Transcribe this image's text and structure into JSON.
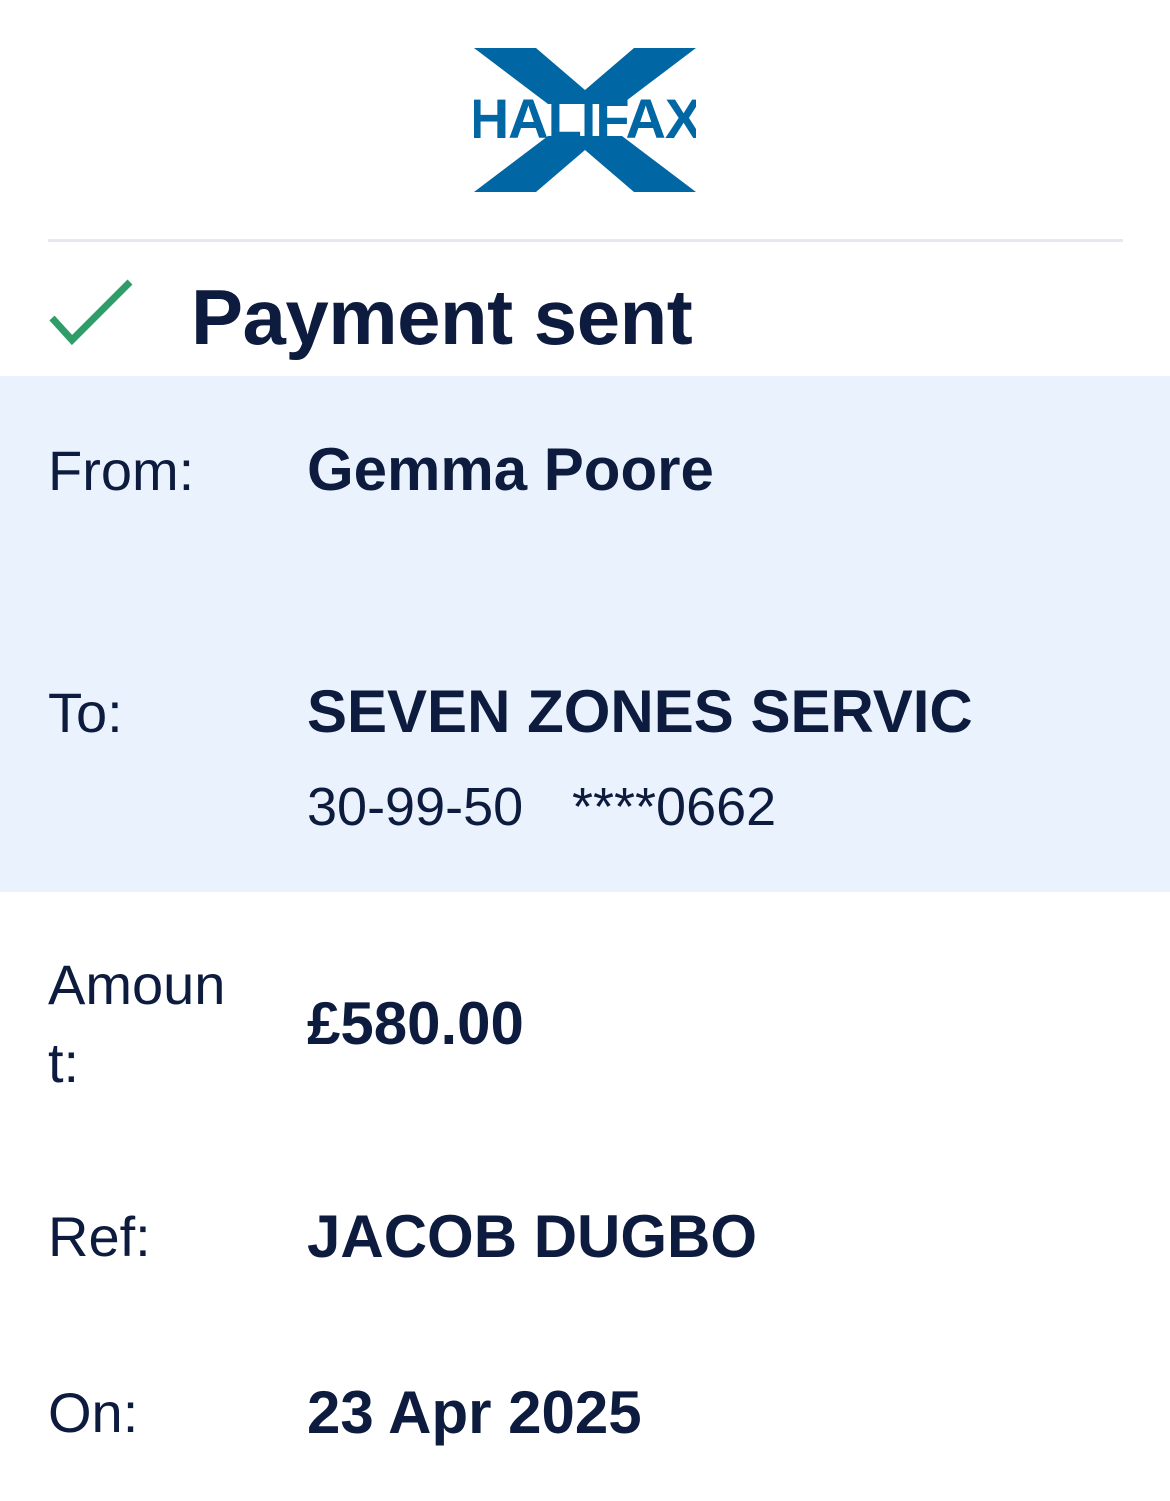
{
  "brand": {
    "name": "HALIFAX",
    "color": "#0066a4"
  },
  "status": {
    "icon": "checkmark-icon",
    "icon_color": "#2f9d67",
    "title": "Payment sent"
  },
  "details": {
    "from_label": "From:",
    "from_value": "Gemma Poore",
    "to_label": "To:",
    "to_value": "SEVEN ZONES SERVIC",
    "to_sort_code": "30-99-50",
    "to_account": "****0662",
    "amount_label": "Amount:",
    "amount_value": "£580.00",
    "ref_label": "Ref:",
    "ref_value": "JACOB DUGBO",
    "on_label": "On:",
    "on_value": "23 Apr 2025"
  },
  "colors": {
    "text": "#0d1b3e",
    "shaded_background": "#eaf3fd",
    "divider": "#e6e8ef"
  }
}
